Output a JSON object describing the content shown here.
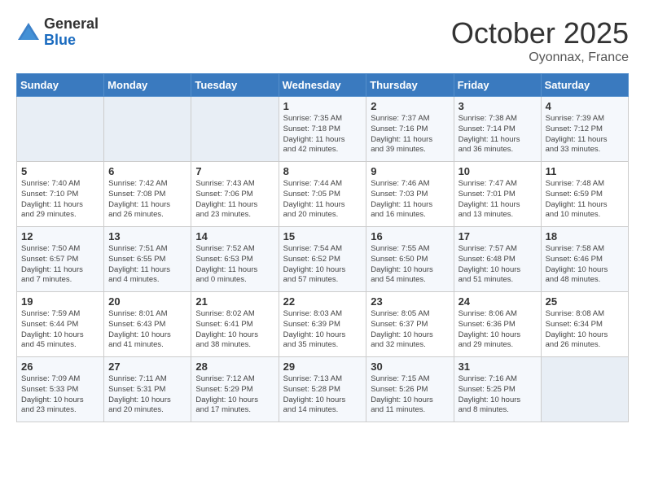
{
  "header": {
    "logo_general": "General",
    "logo_blue": "Blue",
    "month_title": "October 2025",
    "location": "Oyonnax, France"
  },
  "weekdays": [
    "Sunday",
    "Monday",
    "Tuesday",
    "Wednesday",
    "Thursday",
    "Friday",
    "Saturday"
  ],
  "weeks": [
    [
      {
        "day": "",
        "info": ""
      },
      {
        "day": "",
        "info": ""
      },
      {
        "day": "",
        "info": ""
      },
      {
        "day": "1",
        "info": "Sunrise: 7:35 AM\nSunset: 7:18 PM\nDaylight: 11 hours\nand 42 minutes."
      },
      {
        "day": "2",
        "info": "Sunrise: 7:37 AM\nSunset: 7:16 PM\nDaylight: 11 hours\nand 39 minutes."
      },
      {
        "day": "3",
        "info": "Sunrise: 7:38 AM\nSunset: 7:14 PM\nDaylight: 11 hours\nand 36 minutes."
      },
      {
        "day": "4",
        "info": "Sunrise: 7:39 AM\nSunset: 7:12 PM\nDaylight: 11 hours\nand 33 minutes."
      }
    ],
    [
      {
        "day": "5",
        "info": "Sunrise: 7:40 AM\nSunset: 7:10 PM\nDaylight: 11 hours\nand 29 minutes."
      },
      {
        "day": "6",
        "info": "Sunrise: 7:42 AM\nSunset: 7:08 PM\nDaylight: 11 hours\nand 26 minutes."
      },
      {
        "day": "7",
        "info": "Sunrise: 7:43 AM\nSunset: 7:06 PM\nDaylight: 11 hours\nand 23 minutes."
      },
      {
        "day": "8",
        "info": "Sunrise: 7:44 AM\nSunset: 7:05 PM\nDaylight: 11 hours\nand 20 minutes."
      },
      {
        "day": "9",
        "info": "Sunrise: 7:46 AM\nSunset: 7:03 PM\nDaylight: 11 hours\nand 16 minutes."
      },
      {
        "day": "10",
        "info": "Sunrise: 7:47 AM\nSunset: 7:01 PM\nDaylight: 11 hours\nand 13 minutes."
      },
      {
        "day": "11",
        "info": "Sunrise: 7:48 AM\nSunset: 6:59 PM\nDaylight: 11 hours\nand 10 minutes."
      }
    ],
    [
      {
        "day": "12",
        "info": "Sunrise: 7:50 AM\nSunset: 6:57 PM\nDaylight: 11 hours\nand 7 minutes."
      },
      {
        "day": "13",
        "info": "Sunrise: 7:51 AM\nSunset: 6:55 PM\nDaylight: 11 hours\nand 4 minutes."
      },
      {
        "day": "14",
        "info": "Sunrise: 7:52 AM\nSunset: 6:53 PM\nDaylight: 11 hours\nand 0 minutes."
      },
      {
        "day": "15",
        "info": "Sunrise: 7:54 AM\nSunset: 6:52 PM\nDaylight: 10 hours\nand 57 minutes."
      },
      {
        "day": "16",
        "info": "Sunrise: 7:55 AM\nSunset: 6:50 PM\nDaylight: 10 hours\nand 54 minutes."
      },
      {
        "day": "17",
        "info": "Sunrise: 7:57 AM\nSunset: 6:48 PM\nDaylight: 10 hours\nand 51 minutes."
      },
      {
        "day": "18",
        "info": "Sunrise: 7:58 AM\nSunset: 6:46 PM\nDaylight: 10 hours\nand 48 minutes."
      }
    ],
    [
      {
        "day": "19",
        "info": "Sunrise: 7:59 AM\nSunset: 6:44 PM\nDaylight: 10 hours\nand 45 minutes."
      },
      {
        "day": "20",
        "info": "Sunrise: 8:01 AM\nSunset: 6:43 PM\nDaylight: 10 hours\nand 41 minutes."
      },
      {
        "day": "21",
        "info": "Sunrise: 8:02 AM\nSunset: 6:41 PM\nDaylight: 10 hours\nand 38 minutes."
      },
      {
        "day": "22",
        "info": "Sunrise: 8:03 AM\nSunset: 6:39 PM\nDaylight: 10 hours\nand 35 minutes."
      },
      {
        "day": "23",
        "info": "Sunrise: 8:05 AM\nSunset: 6:37 PM\nDaylight: 10 hours\nand 32 minutes."
      },
      {
        "day": "24",
        "info": "Sunrise: 8:06 AM\nSunset: 6:36 PM\nDaylight: 10 hours\nand 29 minutes."
      },
      {
        "day": "25",
        "info": "Sunrise: 8:08 AM\nSunset: 6:34 PM\nDaylight: 10 hours\nand 26 minutes."
      }
    ],
    [
      {
        "day": "26",
        "info": "Sunrise: 7:09 AM\nSunset: 5:33 PM\nDaylight: 10 hours\nand 23 minutes."
      },
      {
        "day": "27",
        "info": "Sunrise: 7:11 AM\nSunset: 5:31 PM\nDaylight: 10 hours\nand 20 minutes."
      },
      {
        "day": "28",
        "info": "Sunrise: 7:12 AM\nSunset: 5:29 PM\nDaylight: 10 hours\nand 17 minutes."
      },
      {
        "day": "29",
        "info": "Sunrise: 7:13 AM\nSunset: 5:28 PM\nDaylight: 10 hours\nand 14 minutes."
      },
      {
        "day": "30",
        "info": "Sunrise: 7:15 AM\nSunset: 5:26 PM\nDaylight: 10 hours\nand 11 minutes."
      },
      {
        "day": "31",
        "info": "Sunrise: 7:16 AM\nSunset: 5:25 PM\nDaylight: 10 hours\nand 8 minutes."
      },
      {
        "day": "",
        "info": ""
      }
    ]
  ]
}
